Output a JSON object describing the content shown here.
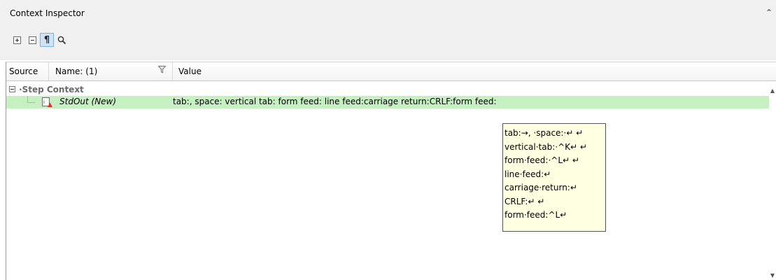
{
  "panel": {
    "title": "Context Inspector",
    "collapse_glyph": "«"
  },
  "toolbar": {
    "buttons": [
      {
        "name": "expand-all",
        "icon": "plus-box-icon"
      },
      {
        "name": "collapse-all",
        "icon": "minus-box-icon"
      },
      {
        "name": "show-whitespace",
        "icon": "pilcrow-icon",
        "glyph": "¶",
        "pressed": true
      },
      {
        "name": "search",
        "icon": "search-icon"
      }
    ]
  },
  "grid": {
    "columns": {
      "source": "Source",
      "name": "Name: (1)",
      "value": "Value"
    },
    "group": {
      "toggle": "minus",
      "label": "Step Context"
    },
    "rows": [
      {
        "name": "StdOut (New)",
        "icon": "stdout-variable-icon",
        "value": "tab:, space: vertical tab:   form feed:   line feed:carriage return:CRLF:form feed:",
        "highlight_color": "#c6f0c2"
      }
    ]
  },
  "tooltip": {
    "lines": [
      "tab:→, ·space:·↵ ↵",
      "vertical·tab:·^K↵ ↵",
      "form·feed:·^L↵ ↵",
      "line·feed:↵",
      "carriage·return:↵",
      "CRLF:↵ ↵",
      "form·feed:^L↵"
    ]
  },
  "colors": {
    "row_highlight": "#c6f0c2",
    "tooltip_bg": "#ffffe1",
    "chrome": "#f0f0f0"
  }
}
